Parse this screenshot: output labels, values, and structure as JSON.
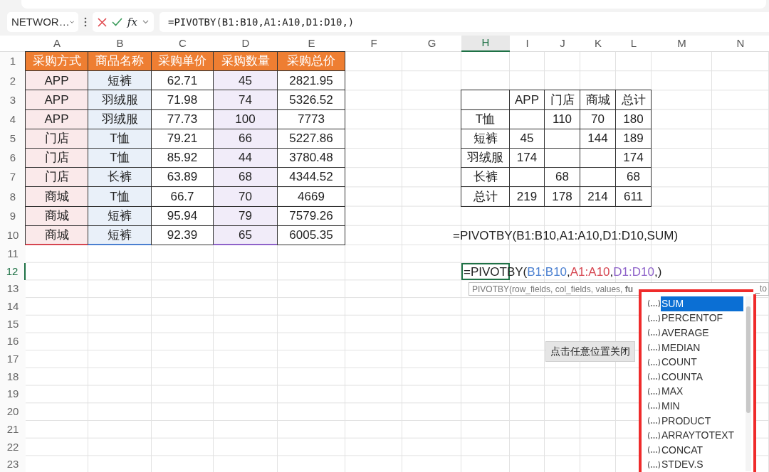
{
  "name_box": {
    "value": "NETWOR…"
  },
  "formula_bar": {
    "fx": "fx",
    "formula": "=PIVOTBY(B1:B10,A1:A10,D1:D10,)"
  },
  "columns": [
    {
      "label": "A",
      "selected": false
    },
    {
      "label": "B",
      "selected": false
    },
    {
      "label": "C",
      "selected": false
    },
    {
      "label": "D",
      "selected": false
    },
    {
      "label": "E",
      "selected": false
    },
    {
      "label": "F",
      "selected": false
    },
    {
      "label": "G",
      "selected": false
    },
    {
      "label": "H",
      "selected": true
    },
    {
      "label": "I",
      "selected": false
    },
    {
      "label": "J",
      "selected": false
    },
    {
      "label": "K",
      "selected": false
    },
    {
      "label": "L",
      "selected": false
    },
    {
      "label": "M",
      "selected": false
    },
    {
      "label": "N",
      "selected": false
    }
  ],
  "rows": [
    {
      "label": "1",
      "selected": false
    },
    {
      "label": "2",
      "selected": false
    },
    {
      "label": "3",
      "selected": false
    },
    {
      "label": "4",
      "selected": false
    },
    {
      "label": "5",
      "selected": false
    },
    {
      "label": "6",
      "selected": false
    },
    {
      "label": "7",
      "selected": false
    },
    {
      "label": "8",
      "selected": false
    },
    {
      "label": "9",
      "selected": false
    },
    {
      "label": "10",
      "selected": false
    },
    {
      "label": "11",
      "selected": false
    },
    {
      "label": "12",
      "selected": true
    },
    {
      "label": "13",
      "selected": false
    },
    {
      "label": "14",
      "selected": false
    },
    {
      "label": "15",
      "selected": false
    },
    {
      "label": "16",
      "selected": false
    },
    {
      "label": "17",
      "selected": false
    },
    {
      "label": "18",
      "selected": false
    },
    {
      "label": "19",
      "selected": false
    },
    {
      "label": "20",
      "selected": false
    },
    {
      "label": "21",
      "selected": false
    },
    {
      "label": "22",
      "selected": false
    },
    {
      "label": "23",
      "selected": false
    }
  ],
  "source_table": {
    "headers": [
      "采购方式",
      "商品名称",
      "采购单价",
      "采购数量",
      "采购总价"
    ],
    "rows": [
      [
        "APP",
        "短裤",
        "62.71",
        "45",
        "2821.95"
      ],
      [
        "APP",
        "羽绒服",
        "71.98",
        "74",
        "5326.52"
      ],
      [
        "APP",
        "羽绒服",
        "77.73",
        "100",
        "7773"
      ],
      [
        "门店",
        "T恤",
        "79.21",
        "66",
        "5227.86"
      ],
      [
        "门店",
        "T恤",
        "85.92",
        "44",
        "3780.48"
      ],
      [
        "门店",
        "长裤",
        "63.89",
        "68",
        "4344.52"
      ],
      [
        "商城",
        "T恤",
        "66.7",
        "70",
        "4669"
      ],
      [
        "商城",
        "短裤",
        "95.94",
        "79",
        "7579.26"
      ],
      [
        "商城",
        "短裤",
        "92.39",
        "65",
        "6005.35"
      ]
    ]
  },
  "pivot_table": {
    "headers": [
      "APP",
      "门店",
      "商城",
      "总计"
    ],
    "rows": [
      [
        "T恤",
        "",
        "110",
        "70",
        "180"
      ],
      [
        "短裤",
        "45",
        "",
        "144",
        "189"
      ],
      [
        "羽绒服",
        "174",
        "",
        "",
        "174"
      ],
      [
        "长裤",
        "",
        "68",
        "",
        "68"
      ],
      [
        "总计",
        "219",
        "178",
        "214",
        "611"
      ]
    ]
  },
  "formula_text": "=PIVOTBY(B1:B10,A1:A10,D1:D10,SUM)",
  "editing_cell": {
    "parts": [
      {
        "text": "=PIVOTBY("
      },
      {
        "text": "B1:B10",
        "color": "#4a7fd0"
      },
      {
        "text": ","
      },
      {
        "text": "A1:A10",
        "color": "#d64550"
      },
      {
        "text": ","
      },
      {
        "text": "D1:D10",
        "color": "#8e62c9"
      },
      {
        "text": ",)"
      }
    ]
  },
  "tooltip": {
    "text": "PIVOTBY(row_fields, col_fields, values, **fu**",
    "tail": "_to"
  },
  "close_hint": "点击任意位置关闭",
  "dropdown": {
    "items": [
      {
        "label": "SUM",
        "selected": true
      },
      {
        "label": "PERCENTOF",
        "selected": false
      },
      {
        "label": "AVERAGE",
        "selected": false
      },
      {
        "label": "MEDIAN",
        "selected": false
      },
      {
        "label": "COUNT",
        "selected": false
      },
      {
        "label": "COUNTA",
        "selected": false
      },
      {
        "label": "MAX",
        "selected": false
      },
      {
        "label": "MIN",
        "selected": false
      },
      {
        "label": "PRODUCT",
        "selected": false
      },
      {
        "label": "ARRAYTOTEXT",
        "selected": false
      },
      {
        "label": "CONCAT",
        "selected": false
      },
      {
        "label": "STDEV.S",
        "selected": false
      }
    ]
  }
}
